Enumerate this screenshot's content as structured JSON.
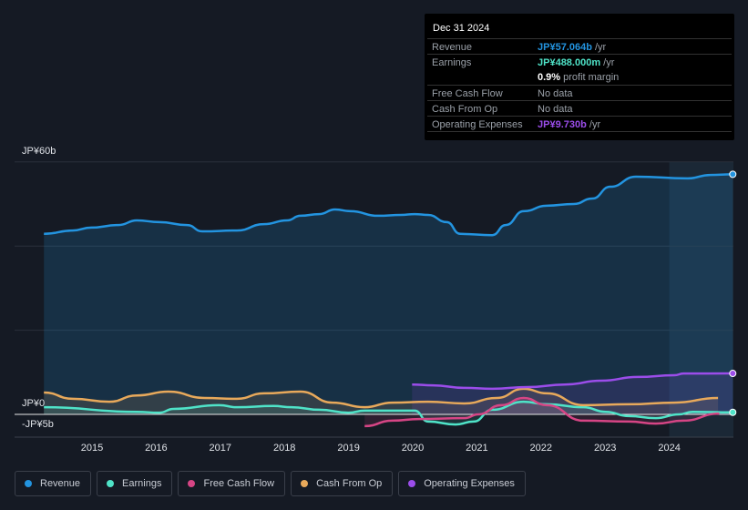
{
  "tooltip": {
    "date": "Dec 31 2024",
    "rows": [
      {
        "label": "Revenue",
        "value": "JP¥57.064b",
        "unit": " /yr",
        "color": "#2394e0"
      },
      {
        "label": "Earnings",
        "value": "JP¥488.000m",
        "unit": " /yr",
        "color": "#4fe3c8"
      },
      {
        "label": "",
        "value": "0.9%",
        "unit": " profit margin",
        "color": "#ffffff"
      },
      {
        "label": "Free Cash Flow",
        "value": "",
        "unit": "No data",
        "color": "#777"
      },
      {
        "label": "Cash From Op",
        "value": "",
        "unit": "No data",
        "color": "#777"
      },
      {
        "label": "Operating Expenses",
        "value": "JP¥9.730b",
        "unit": " /yr",
        "color": "#9b4dea"
      }
    ]
  },
  "legend": [
    {
      "label": "Revenue",
      "color": "#2394e0"
    },
    {
      "label": "Earnings",
      "color": "#4fe3c8"
    },
    {
      "label": "Free Cash Flow",
      "color": "#d64585"
    },
    {
      "label": "Cash From Op",
      "color": "#e8a95b"
    },
    {
      "label": "Operating Expenses",
      "color": "#9b4dea"
    }
  ],
  "chart_data": {
    "type": "line",
    "y_tick_labels": [
      "JP¥60b",
      "JP¥0",
      "-JP¥5b"
    ],
    "x_tick_labels": [
      "2015",
      "2016",
      "2017",
      "2018",
      "2019",
      "2020",
      "2021",
      "2022",
      "2023",
      "2024"
    ],
    "ylim": [
      -5,
      60
    ],
    "xlim": [
      2014.0,
      2025.0
    ],
    "unit": "JP¥ billions",
    "series": [
      {
        "name": "Revenue",
        "color": "#2394e0",
        "fill": true,
        "x": [
          2014.25,
          2014.7,
          2014.99,
          2015.41,
          2015.7,
          2016.05,
          2016.48,
          2016.72,
          2017.26,
          2017.68,
          2018.04,
          2018.25,
          2018.54,
          2018.79,
          2019.03,
          2019.46,
          2019.82,
          2020.03,
          2020.24,
          2020.53,
          2020.74,
          2021.24,
          2021.45,
          2021.73,
          2022.09,
          2022.51,
          2022.8,
          2023.08,
          2023.48,
          2024.29,
          2024.64,
          2024.99
        ],
        "y": [
          42.9,
          43.7,
          44.4,
          45.0,
          46.1,
          45.7,
          45.0,
          43.5,
          43.7,
          45.2,
          46.1,
          47.2,
          47.6,
          48.7,
          48.3,
          47.2,
          47.4,
          47.6,
          47.4,
          45.7,
          42.9,
          42.6,
          45.0,
          48.3,
          49.6,
          50.0,
          51.3,
          54.1,
          56.5,
          56.1,
          56.9,
          57.06
        ]
      },
      {
        "name": "Earnings",
        "color": "#4fe3c8",
        "fill": true,
        "x": [
          2014.25,
          2015.7,
          2016.05,
          2016.27,
          2016.98,
          2017.26,
          2017.83,
          2018.11,
          2018.54,
          2019.0,
          2019.25,
          2020.03,
          2020.24,
          2020.67,
          2020.95,
          2021.24,
          2021.73,
          2022.09,
          2022.66,
          2023.01,
          2023.37,
          2023.79,
          2024.15,
          2024.36,
          2024.99
        ],
        "y": [
          1.7,
          0.6,
          0.4,
          1.3,
          2.2,
          1.7,
          2.0,
          1.7,
          1.1,
          0.4,
          0.9,
          0.9,
          -1.7,
          -2.4,
          -1.7,
          1.1,
          3.0,
          2.4,
          1.7,
          0.6,
          -0.4,
          -0.9,
          0.0,
          0.6,
          0.49
        ]
      },
      {
        "name": "Free Cash Flow",
        "color": "#d64585",
        "fill": true,
        "x": [
          2019.25,
          2019.68,
          2020.1,
          2020.81,
          2021.02,
          2021.38,
          2021.73,
          2022.09,
          2022.66,
          2023.37,
          2023.79,
          2024.22,
          2024.78
        ],
        "y": [
          -2.8,
          -1.5,
          -1.1,
          -0.9,
          0.0,
          2.2,
          3.9,
          2.2,
          -1.5,
          -1.7,
          -2.2,
          -1.5,
          0.2
        ]
      },
      {
        "name": "Cash From Op",
        "color": "#e8a95b",
        "fill": true,
        "x": [
          2014.25,
          2014.7,
          2015.27,
          2015.7,
          2016.19,
          2016.76,
          2017.26,
          2017.68,
          2018.25,
          2018.75,
          2019.25,
          2019.68,
          2020.24,
          2020.81,
          2021.31,
          2021.73,
          2022.09,
          2022.66,
          2023.37,
          2024.08,
          2024.76
        ],
        "y": [
          5.2,
          3.7,
          3.0,
          4.5,
          5.4,
          3.9,
          3.7,
          5.0,
          5.4,
          2.8,
          1.7,
          2.8,
          3.0,
          2.6,
          3.9,
          6.1,
          5.0,
          2.2,
          2.4,
          2.8,
          3.9
        ]
      },
      {
        "name": "Operating Expenses",
        "color": "#9b4dea",
        "fill": true,
        "x": [
          2019.99,
          2020.31,
          2020.81,
          2021.24,
          2021.8,
          2022.37,
          2022.94,
          2023.51,
          2024.08,
          2024.22,
          2024.99
        ],
        "y": [
          7.1,
          6.9,
          6.3,
          6.1,
          6.5,
          7.1,
          8.0,
          8.9,
          9.3,
          9.7,
          9.73
        ]
      }
    ],
    "highlight_from": 2024.0,
    "grid": true
  }
}
